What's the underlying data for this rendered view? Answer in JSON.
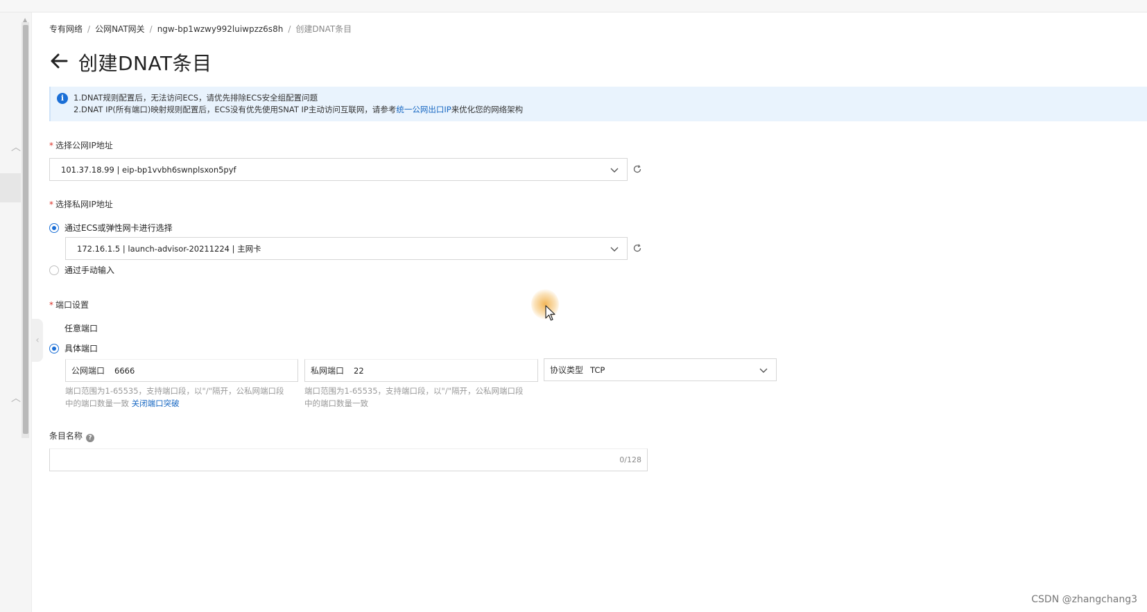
{
  "breadcrumb": {
    "items": [
      "专有网络",
      "公网NAT网关",
      "ngw-bp1wzwy992luiwpzz6s8h"
    ],
    "current": "创建DNAT条目",
    "separator": "/"
  },
  "page": {
    "title": "创建DNAT条目"
  },
  "notice": {
    "line1": "1.DNAT规则配置后，无法访问ECS，请优先排除ECS安全组配置问题",
    "line2_prefix": "2.DNAT IP(所有端口)映射规则配置后，ECS没有优先使用SNAT IP主动访问互联网，请参考",
    "line2_link": "统一公网出口IP",
    "line2_suffix": "来优化您的网络架构"
  },
  "public_ip": {
    "label": "选择公网IP地址",
    "value": "101.37.18.99 | eip-bp1vvbh6swnplsxon5pyf"
  },
  "private_ip": {
    "label": "选择私网IP地址",
    "option_ecs": "通过ECS或弹性网卡进行选择",
    "ecs_value": "172.16.1.5 | launch-advisor-20211224 | 主网卡",
    "option_manual": "通过手动输入"
  },
  "port": {
    "label": "端口设置",
    "option_any": "任意端口",
    "option_specific": "具体端口",
    "public_port_label": "公网端口",
    "public_port_value": "6666",
    "private_port_label": "私网端口",
    "private_port_value": "22",
    "protocol_label": "协议类型",
    "protocol_value": "TCP",
    "public_hint_line1": "端口范围为1-65535，支持端口段，以\"/\"隔开，公私网端口段",
    "public_hint_line2": "中的端口数量一致",
    "public_hint_link": "关闭端口突破",
    "private_hint_line1": "端口范围为1-65535，支持端口段，以\"/\"隔开，公私网端口段",
    "private_hint_line2": "中的端口数量一致"
  },
  "entry_name": {
    "label": "条目名称",
    "value": "",
    "counter": "0/128"
  },
  "watermark": "CSDN @zhangchang3",
  "colors": {
    "primary": "#1b6fd6",
    "link": "#1767c2",
    "notice_bg": "#e9f3fd",
    "required": "#d93026"
  },
  "icons": [
    "back-arrow-icon",
    "info-icon",
    "chevron-down-icon",
    "refresh-icon",
    "help-icon",
    "mouse-cursor-icon"
  ]
}
